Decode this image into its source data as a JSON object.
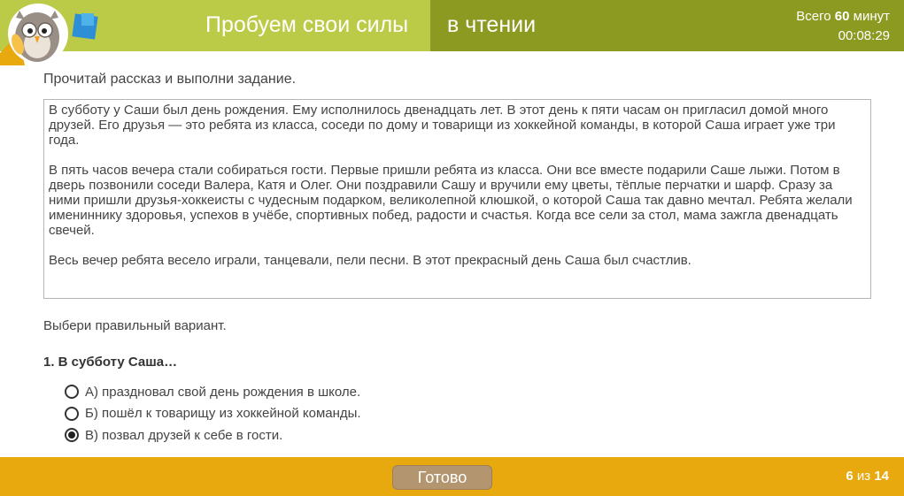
{
  "header": {
    "title_main": "Пробуем свои силы",
    "title_sub": "в чтении",
    "timer_total_prefix": "Всего",
    "timer_total_value": "60",
    "timer_total_suffix": "минут",
    "timer_elapsed": "00:08:29"
  },
  "colors": {
    "header_left": "#bccb47",
    "header_right": "#8d9a22",
    "footer": "#e8a90e",
    "button": "#b39570"
  },
  "content": {
    "instruction": "Прочитай рассказ и выполни задание.",
    "story_paragraphs": [
      "В субботу у Саши был день рождения. Ему исполнилось двенадцать лет. В этот день к пяти часам он пригласил домой много друзей. Его друзья — это ребята из класса, соседи по дому и товарищи из хоккейной команды, в которой Саша играет уже три года.",
      "В пять часов вечера стали собираться гости. Первые пришли ребята из класса. Они все вместе подарили Саше лыжи. Потом в дверь позвонили соседи Валера, Катя и Олег. Они поздравили Сашу и вручили ему цветы, тёплые перчатки и шарф. Сразу за ними пришли друзья-хоккеисты с чудесным подарком, великолепной клюшкой, о которой Саша так давно мечтал. Ребята желали имениннику здоровья, успехов в учёбе, спортивных побед, радости и счастья. Когда все сели за стол, мама зажгла двенадцать свечей.",
      "Весь вечер ребята весело играли, танцевали, пели песни. В этот прекрасный день Саша был счастлив."
    ],
    "choose_prompt": "Выбери правильный вариант.",
    "question": "1. В субботу Саша…",
    "options": [
      {
        "label": "А) праздновал свой день рождения в школе.",
        "selected": false
      },
      {
        "label": "Б) пошёл к товарищу из хоккейной команды.",
        "selected": false
      },
      {
        "label": "В) позвал друзей к себе в гости.",
        "selected": true
      }
    ]
  },
  "footer": {
    "done_label": "Готово",
    "page_current": "6",
    "page_of": "из",
    "page_total": "14"
  }
}
